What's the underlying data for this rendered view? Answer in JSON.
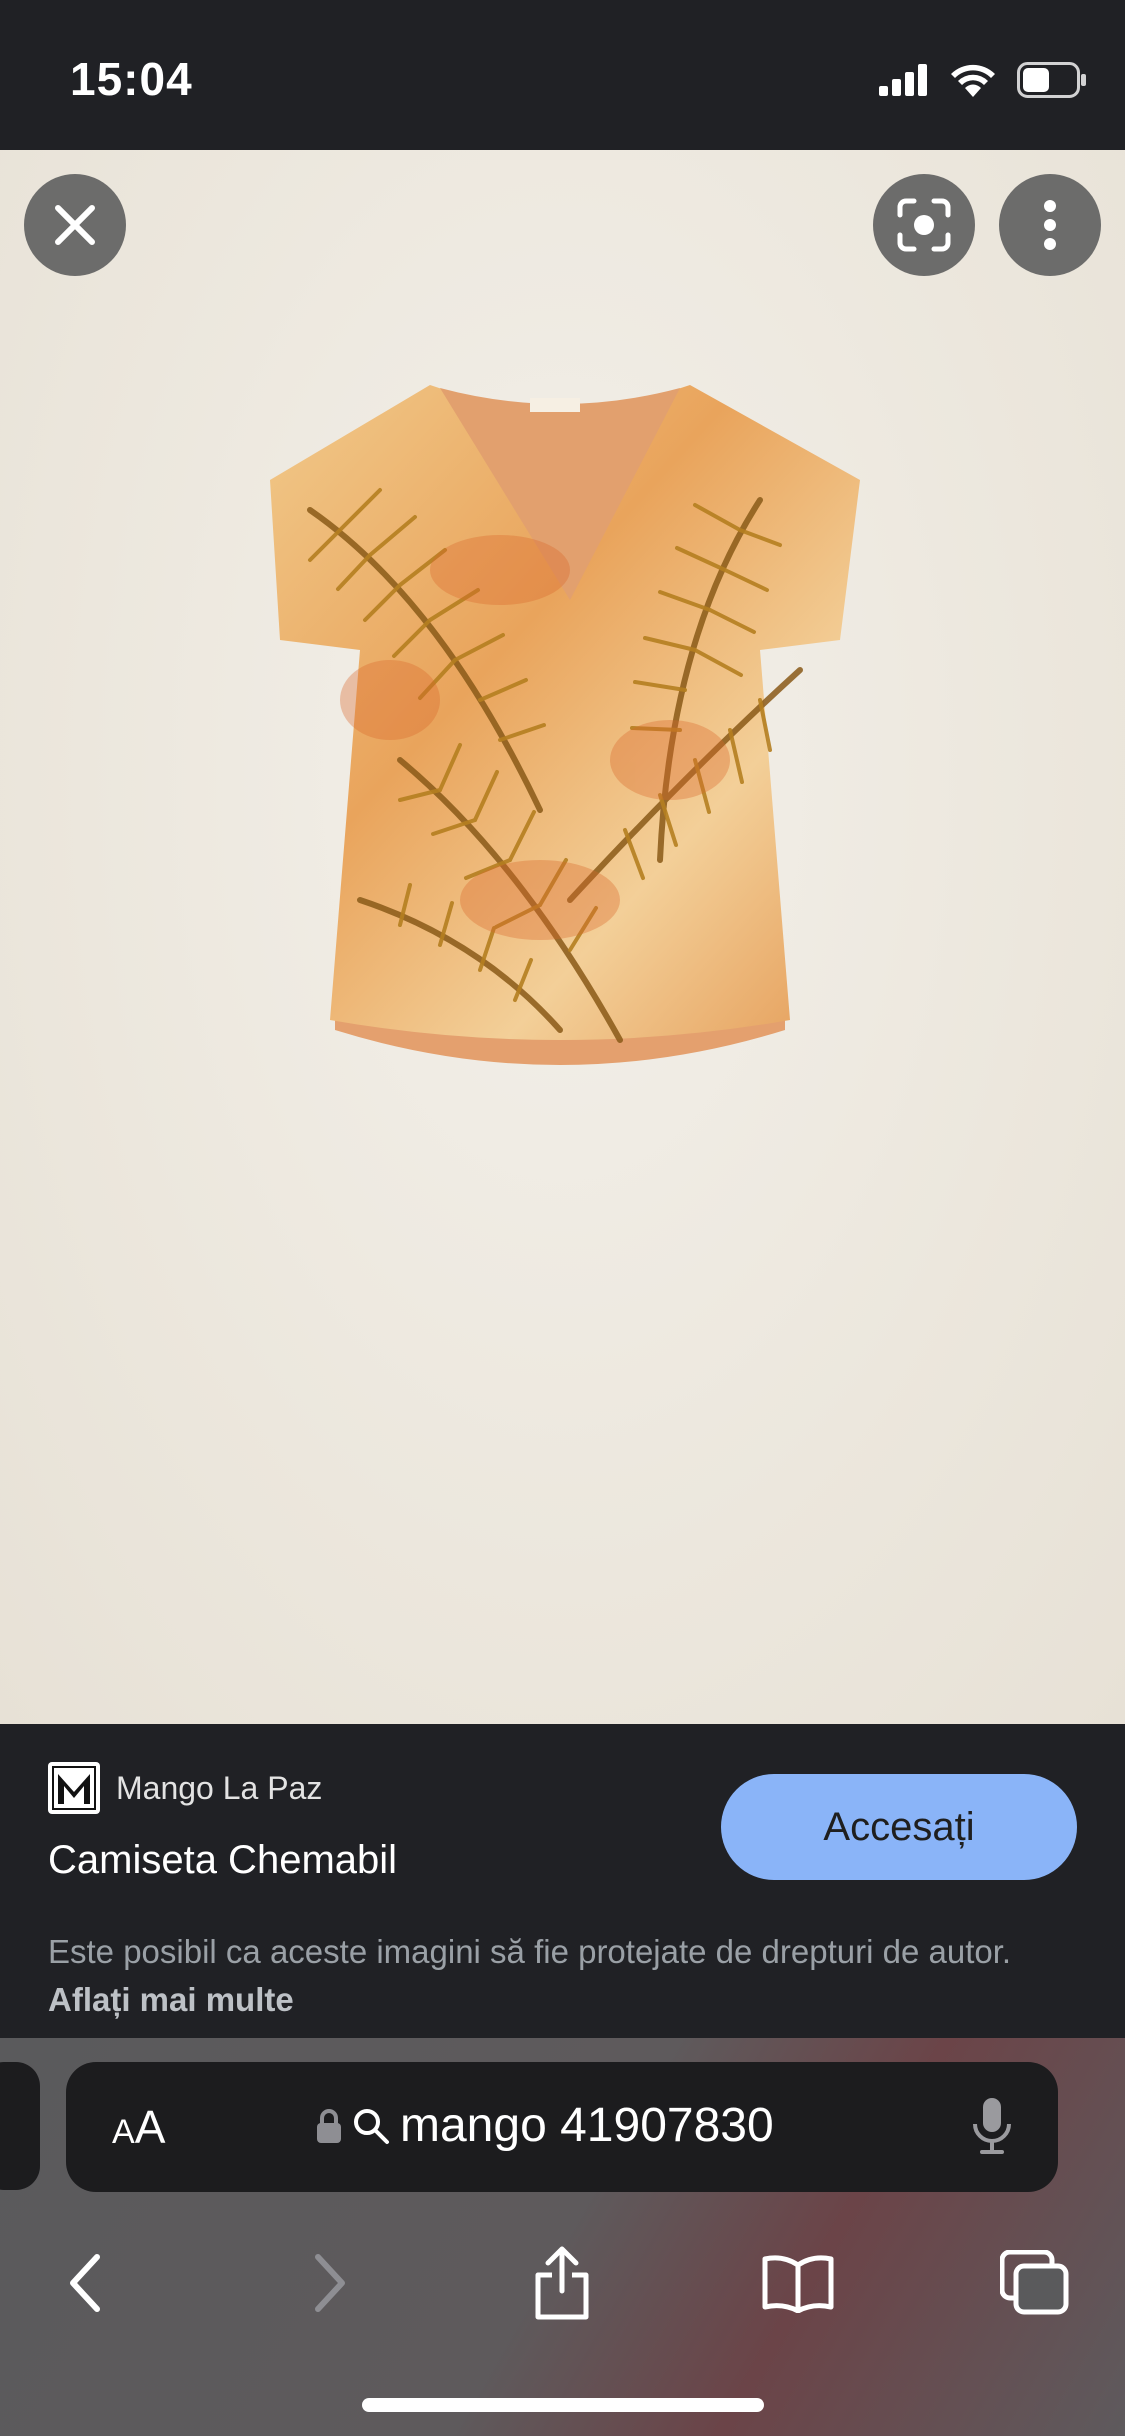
{
  "status_bar": {
    "time": "15:04"
  },
  "viewer": {
    "close_icon": "close-icon",
    "lens_icon": "lens-icon",
    "more_icon": "more-vert-icon"
  },
  "info": {
    "source_logo_letter": "M",
    "source_name": "Mango La Paz",
    "title": "Camiseta Chemabil",
    "visit_label": "Accesați",
    "copyright_text": "Este posibil ca aceste imagini să fie protejate de drepturi de autor.",
    "learn_more": "Aflați mai multe"
  },
  "safari": {
    "aa_small": "A",
    "aa_large": "A",
    "url_text": "mango 41907830"
  },
  "colors": {
    "dark_bg": "#202125",
    "accent_button": "#8ab4f8",
    "image_bg": "#efebe3"
  }
}
